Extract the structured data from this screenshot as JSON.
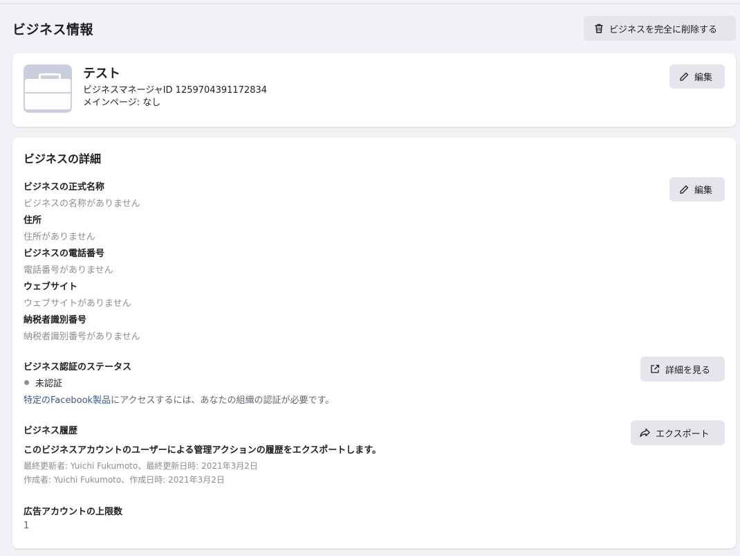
{
  "page": {
    "title": "ビジネス情報",
    "delete_button": "ビジネスを完全に削除する"
  },
  "profile": {
    "name": "テスト",
    "business_manager_id": "ビジネスマネージャID 1259704391172834",
    "main_page": "メインページ: なし",
    "edit_button": "編集"
  },
  "details": {
    "title": "ビジネスの詳細",
    "edit_button": "編集",
    "fields": [
      {
        "label": "ビジネスの正式名称",
        "value": "ビジネスの名称がありません"
      },
      {
        "label": "住所",
        "value": "住所がありません"
      },
      {
        "label": "ビジネスの電話番号",
        "value": "電話番号がありません"
      },
      {
        "label": "ウェブサイト",
        "value": "ウェブサイトがありません"
      },
      {
        "label": "納税者識別番号",
        "value": "納税者識別番号がありません"
      }
    ],
    "verification": {
      "title": "ビジネス認証のステータス",
      "status": "未認証",
      "note_link": "特定のFacebook製品",
      "note_rest": "にアクセスするには、あなたの組織の認証が必要です。",
      "details_button": "詳細を見る"
    },
    "history": {
      "title": "ビジネス履歴",
      "description": "このビジネスアカウントのユーザーによる管理アクションの履歴をエクスポートします。",
      "last_updated": "最終更新者: Yuichi Fukumoto、最終更新日時: 2021年3月2日",
      "created": "作成者: Yuichi Fukumoto、作成日時: 2021年3月2日",
      "export_button": "エクスポート"
    },
    "ad_account_limit": {
      "title": "広告アカウントの上限数",
      "value": "1"
    }
  },
  "colors": {
    "background": "#f0f2f5",
    "card": "#ffffff",
    "button": "#e4e6eb",
    "muted_text": "#8a8d91",
    "link": "#385898"
  }
}
